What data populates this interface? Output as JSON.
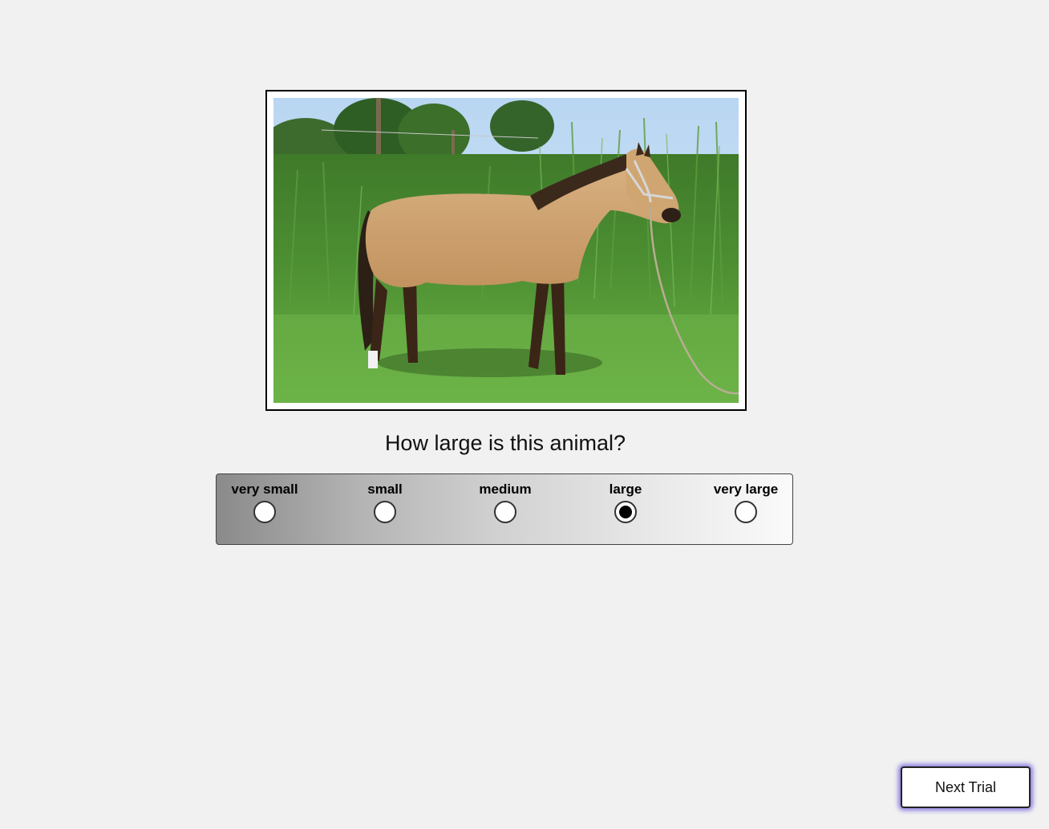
{
  "stimulus": {
    "image_subject": "buckskin-horse-in-grass-field"
  },
  "question": {
    "text": "How large is this animal?"
  },
  "scale": {
    "options": [
      {
        "label": "very small",
        "selected": false
      },
      {
        "label": "small",
        "selected": false
      },
      {
        "label": "medium",
        "selected": false
      },
      {
        "label": "large",
        "selected": true
      },
      {
        "label": "very large",
        "selected": false
      }
    ],
    "selected_value": "large"
  },
  "controls": {
    "next_label": "Next Trial"
  },
  "colors": {
    "focus_glow": "#8a7fe0",
    "page_background": "#f1f1f1"
  }
}
